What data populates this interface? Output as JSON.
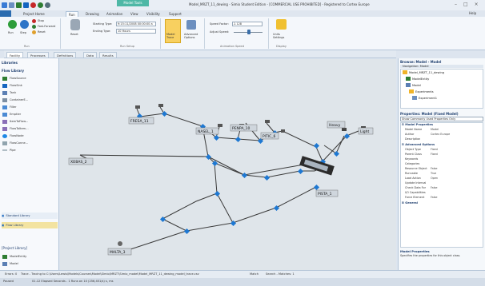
{
  "titlebar": {
    "context_tab": "Model Tools",
    "title": "Model_MRZT_11_dewing - Simio Student Edition - [COMMERCIAL USE PROHIBITED] - Registered to Cortex Europe",
    "help": "Help"
  },
  "menu": {
    "file": "File",
    "tabs": [
      "Project Home",
      "Run",
      "Drawing",
      "Animation",
      "View",
      "Visibility",
      "Support"
    ],
    "active": "Run"
  },
  "ribbon": {
    "run_label": "Run",
    "step_label": "Step",
    "stop_label": "Stop",
    "fast_forward_label": "Fast-Forward",
    "reset_label": "Reset",
    "reset_big_label": "Reset",
    "starting_type_label": "Starting Type:",
    "starting_type_value": "9:15:11/2008 00:00:00 a",
    "ending_type_label": "Ending Type:",
    "ending_type_value": "10 Hours",
    "run_setup_group": "Run Setup",
    "model_trace_label": "Model Trace",
    "advanced_options_label": "Advanced Options",
    "speed_factor_label": "Speed Factor:",
    "speed_factor_value": "2.128",
    "adjust_speed_label": "Adjust Speed:",
    "animation_speed_group": "Animation Speed",
    "units_settings_label": "Units Settings",
    "display_group": "Display",
    "run_group": "Run"
  },
  "facility_tabs": [
    "Facility",
    "Processes",
    "Definitions",
    "Data",
    "Results"
  ],
  "active_facility_tab": "Facility",
  "libraries": {
    "header": "Libraries",
    "flow_library": "Flow Library",
    "items": [
      "FlowSource",
      "FlowSink",
      "Tank",
      "ContainerE...",
      "Filler",
      "Emptier",
      "ItemToFlow...",
      "FlowToItem...",
      "FlowNode",
      "FlowConne...",
      "Pipe"
    ],
    "standard_library": "Standard Library",
    "flow_library_bottom": "Flow Library",
    "project_library": "[Project Library]",
    "project_items": [
      "ModelEntity",
      "Model"
    ]
  },
  "canvas_labels": {
    "fresa": "FRESA_11",
    "nasel": "NASEL_1",
    "penpa": "PENPA_10",
    "pitic": "PITIC_6",
    "heavy": "Heavy",
    "light": "Light",
    "xobas": "XOBAS_2",
    "pista": "PISTA_1",
    "malta": "MALTA_3"
  },
  "navigation": {
    "title": "Browse: Model - Model",
    "header": "Navigation: Model",
    "tree": [
      "Model_MRZT_11_dewing",
      "ModelEntity",
      "Model",
      "Experiments",
      "Experiment1"
    ]
  },
  "properties": {
    "title": "Properties: Model (Fixed Model)",
    "filter_placeholder": "Show Commonly Used Properties Only",
    "categories": {
      "model_properties": "Model Properties",
      "advanced_options": "Advanced Options",
      "general": "General"
    },
    "rows_model": [
      {
        "k": "Model Name",
        "v": "Model"
      },
      {
        "k": "Author",
        "v": "Cortex Europe"
      },
      {
        "k": "Description",
        "v": ""
      }
    ],
    "rows_advanced": [
      {
        "k": "Object Type",
        "v": "Fixed"
      },
      {
        "k": "Parent Class",
        "v": "Fixed"
      },
      {
        "k": "Keywords",
        "v": ""
      },
      {
        "k": "Categories",
        "v": ""
      },
      {
        "k": "Resource Object",
        "v": "False"
      },
      {
        "k": "Runnable",
        "v": "True"
      },
      {
        "k": "Load Action",
        "v": "Open"
      },
      {
        "k": "Update Interval",
        "v": ""
      },
      {
        "k": "Check Data For",
        "v": "False"
      },
      {
        "k": "I/O Capabilities",
        "v": ""
      },
      {
        "k": "Force Element",
        "v": "False"
      }
    ],
    "footer_title": "Model Properties",
    "footer_desc": "Specifies the properties for this object class."
  },
  "bottom_tabs": [
    "Errors: 0",
    "Trace - Tracing to C:\\Users\\Lewis\\Models\\Courses\\Model\\Simio\\MRZT\\Simio_model\\Model_MRZT_11_dewing_model_trace.csv",
    "Match",
    "Search - Matches: 1"
  ],
  "status": {
    "left": "Paused",
    "mid": "01.12 Elapsed Seconds - 1 Runs on 10 (256,451/s) s, ms"
  }
}
